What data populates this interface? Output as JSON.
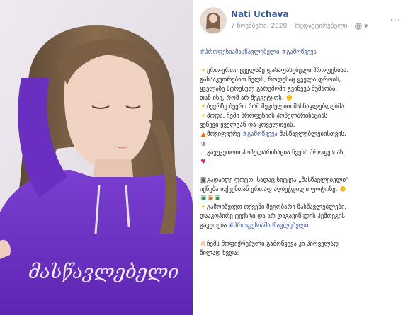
{
  "post": {
    "author": "Nati Uchava",
    "date": "7 ნოემბერი, 2020",
    "edited": "რედაქტირებული",
    "privacy_icon": "globe-icon",
    "more_label": "···"
  },
  "photo": {
    "hoodie_text": "მასწავლებელი",
    "hoodie_color": "#6a2fc0"
  },
  "content": {
    "hashtags_top": "#პროფესიამასწავლებელი #გამოწვევა",
    "p1": [
      "ერთ-ერთი ყველაზე დასაფასებელი პროფესიაა.",
      "განსაკუთრებით წელს, როდესაც ყველა დროის,",
      "ყველაზე სტრესულ გარემოში გვიწევს მუშაობა.",
      "თან ისე, რომ არ შეგვეტყოს."
    ],
    "p2": "ბევრზე ბევრი რამ შევძელით მასწავლებლებმა.",
    "p3": [
      "ჰოდა, ჩემი პროფესიის პოპულარიზაციას",
      "ვეწევი ყველგან და ყოველთვის."
    ],
    "p4_pre": "მოვიფიქრე ",
    "p4_tag": "#გამოწვევა",
    "p4_post": " მასწავლებლებისთვის.",
    "p5": "გავუკეთოთ პოპულარიზაცია ჩვენს პროფესიას.",
    "p6": [
      "გადაიღე ფოტო, სადაც სიტყვა „მასწავლებელი\"",
      "იქნება თქვენთან ერთად აღბეჭდილი ფოტოზე."
    ],
    "p7": [
      "გამოიწვიეთ თქვენი მეგობარი მასწავლებლები.",
      "დააკოპირე ტექსტი და არ დაგავიწყდეს ჰეშთეგის",
      "გაკეთება "
    ],
    "p7_tag": "#პროფესიამასწავლებელი",
    "p8": [
      "ჩემს მოფიქრებული გამოწვევა კი პირველად",
      "წილად ხვდა:"
    ]
  }
}
